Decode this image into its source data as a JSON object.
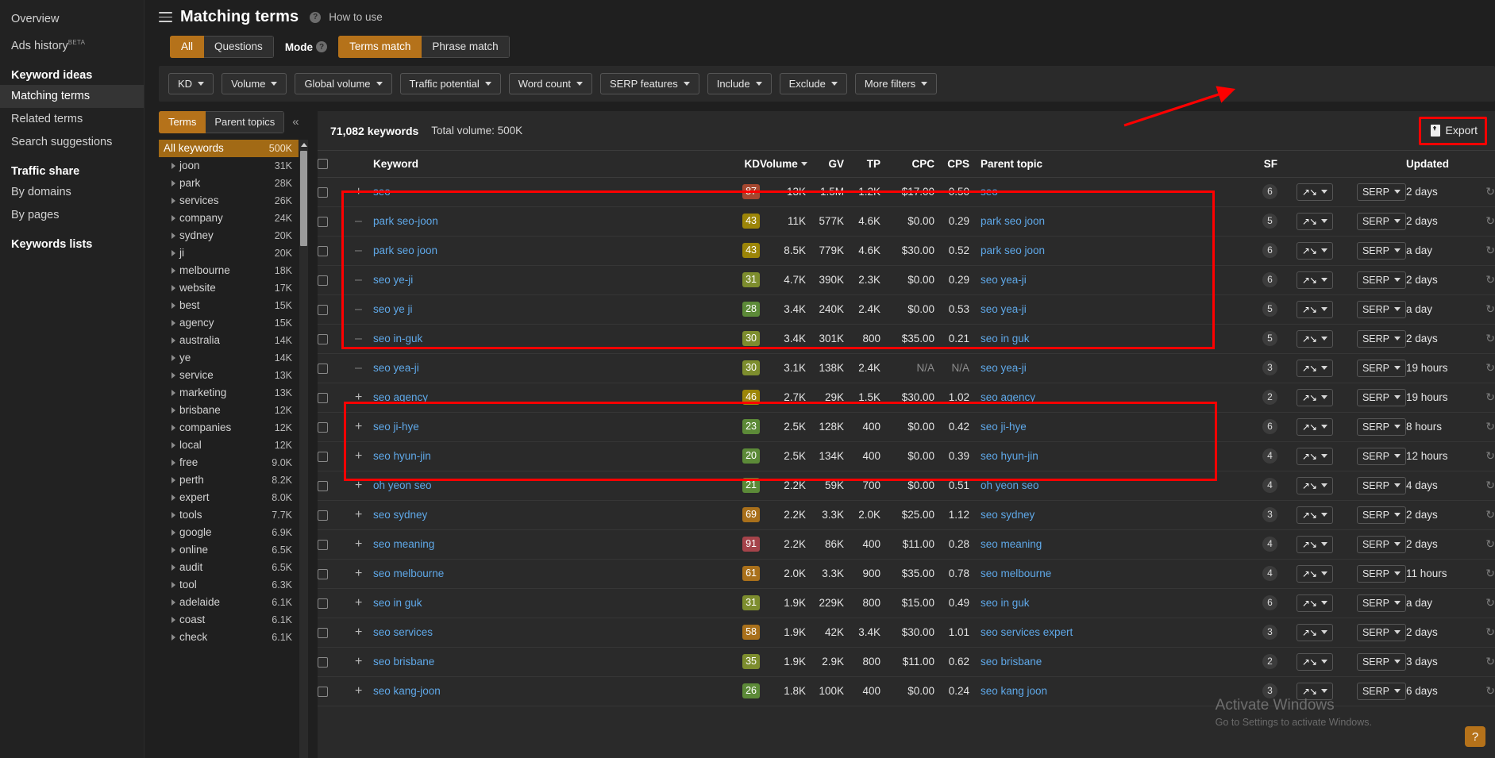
{
  "sidebar": {
    "top_items": [
      {
        "label": "Overview",
        "badge": ""
      },
      {
        "label": "Ads history",
        "badge": "BETA"
      }
    ],
    "sections": [
      {
        "title": "Keyword ideas",
        "items": [
          {
            "label": "Matching terms",
            "active": true
          },
          {
            "label": "Related terms",
            "active": false
          },
          {
            "label": "Search suggestions",
            "active": false
          }
        ]
      },
      {
        "title": "Traffic share",
        "items": [
          {
            "label": "By domains",
            "active": false
          },
          {
            "label": "By pages",
            "active": false
          }
        ]
      }
    ],
    "keywords_lists": "Keywords lists"
  },
  "header": {
    "title": "Matching terms",
    "how_to_use": "How to use",
    "help_icon": "question-mark-icon",
    "menu_icon": "hamburger-menu-icon"
  },
  "segments": {
    "scope": {
      "options": [
        "All",
        "Questions"
      ],
      "selected": "All"
    },
    "mode_label": "Mode",
    "mode": {
      "options": [
        "Terms match",
        "Phrase match"
      ],
      "selected": "Terms match"
    }
  },
  "filters": [
    {
      "label": "KD"
    },
    {
      "label": "Volume"
    },
    {
      "label": "Global volume"
    },
    {
      "label": "Traffic potential"
    },
    {
      "label": "Word count"
    },
    {
      "label": "SERP features"
    },
    {
      "label": "Include"
    },
    {
      "label": "Exclude"
    },
    {
      "label": "More filters"
    }
  ],
  "terms_panel": {
    "tabs": {
      "options": [
        "Terms",
        "Parent topics"
      ],
      "selected": "Terms"
    },
    "collapse_icon": "chevron-double-left-icon",
    "rows": [
      {
        "label": "All keywords",
        "count": "500K",
        "selected": true
      },
      {
        "label": "joon",
        "count": "31K",
        "selected": false
      },
      {
        "label": "park",
        "count": "28K",
        "selected": false
      },
      {
        "label": "services",
        "count": "26K",
        "selected": false
      },
      {
        "label": "company",
        "count": "24K",
        "selected": false
      },
      {
        "label": "sydney",
        "count": "20K",
        "selected": false
      },
      {
        "label": "ji",
        "count": "20K",
        "selected": false
      },
      {
        "label": "melbourne",
        "count": "18K",
        "selected": false
      },
      {
        "label": "website",
        "count": "17K",
        "selected": false
      },
      {
        "label": "best",
        "count": "15K",
        "selected": false
      },
      {
        "label": "agency",
        "count": "15K",
        "selected": false
      },
      {
        "label": "australia",
        "count": "14K",
        "selected": false
      },
      {
        "label": "ye",
        "count": "14K",
        "selected": false
      },
      {
        "label": "service",
        "count": "13K",
        "selected": false
      },
      {
        "label": "marketing",
        "count": "13K",
        "selected": false
      },
      {
        "label": "brisbane",
        "count": "12K",
        "selected": false
      },
      {
        "label": "companies",
        "count": "12K",
        "selected": false
      },
      {
        "label": "local",
        "count": "12K",
        "selected": false
      },
      {
        "label": "free",
        "count": "9.0K",
        "selected": false
      },
      {
        "label": "perth",
        "count": "8.2K",
        "selected": false
      },
      {
        "label": "expert",
        "count": "8.0K",
        "selected": false
      },
      {
        "label": "tools",
        "count": "7.7K",
        "selected": false
      },
      {
        "label": "google",
        "count": "6.9K",
        "selected": false
      },
      {
        "label": "online",
        "count": "6.5K",
        "selected": false
      },
      {
        "label": "audit",
        "count": "6.5K",
        "selected": false
      },
      {
        "label": "tool",
        "count": "6.3K",
        "selected": false
      },
      {
        "label": "adelaide",
        "count": "6.1K",
        "selected": false
      },
      {
        "label": "coast",
        "count": "6.1K",
        "selected": false
      },
      {
        "label": "check",
        "count": "6.1K",
        "selected": false
      }
    ]
  },
  "table": {
    "keyword_count": "71,082 keywords",
    "total_volume": "Total volume: 500K",
    "export_label": "Export",
    "export_icon": "download-document-icon",
    "columns": [
      "Keyword",
      "KD",
      "Volume",
      "GV",
      "TP",
      "CPC",
      "CPS",
      "Parent topic",
      "SF",
      "Updated"
    ],
    "sorted_column": "Volume",
    "serp_label": "SERP",
    "sparkline_icon": "sparkline-icon",
    "refresh_icon": "refresh-icon",
    "rows": [
      {
        "keyword": "seo",
        "kd": "87",
        "kd_color": "#a5472f",
        "volume": "13K",
        "gv": "1.5M",
        "tp": "1.2K",
        "cpc": "$17.00",
        "cps": "0.50",
        "parent": "seo",
        "sf": "6",
        "updated": "2 days",
        "expand": "plus"
      },
      {
        "keyword": "park seo-joon",
        "kd": "43",
        "kd_color": "#9c8508",
        "volume": "11K",
        "gv": "577K",
        "tp": "4.6K",
        "cpc": "$0.00",
        "cps": "0.29",
        "parent": "park seo joon",
        "sf": "5",
        "updated": "2 days",
        "expand": "minus"
      },
      {
        "keyword": "park seo joon",
        "kd": "43",
        "kd_color": "#9c8508",
        "volume": "8.5K",
        "gv": "779K",
        "tp": "4.6K",
        "cpc": "$30.00",
        "cps": "0.52",
        "parent": "park seo joon",
        "sf": "6",
        "updated": "a day",
        "expand": "minus"
      },
      {
        "keyword": "seo ye-ji",
        "kd": "31",
        "kd_color": "#7d8d2e",
        "volume": "4.7K",
        "gv": "390K",
        "tp": "2.3K",
        "cpc": "$0.00",
        "cps": "0.29",
        "parent": "seo yea-ji",
        "sf": "6",
        "updated": "2 days",
        "expand": "minus"
      },
      {
        "keyword": "seo ye ji",
        "kd": "28",
        "kd_color": "#5c8a38",
        "volume": "3.4K",
        "gv": "240K",
        "tp": "2.4K",
        "cpc": "$0.00",
        "cps": "0.53",
        "parent": "seo yea-ji",
        "sf": "5",
        "updated": "a day",
        "expand": "minus"
      },
      {
        "keyword": "seo in-guk",
        "kd": "30",
        "kd_color": "#7d8d2e",
        "volume": "3.4K",
        "gv": "301K",
        "tp": "800",
        "cpc": "$35.00",
        "cps": "0.21",
        "parent": "seo in guk",
        "sf": "5",
        "updated": "2 days",
        "expand": "minus"
      },
      {
        "keyword": "seo yea-ji",
        "kd": "30",
        "kd_color": "#7d8d2e",
        "volume": "3.1K",
        "gv": "138K",
        "tp": "2.4K",
        "cpc": "N/A",
        "cps": "N/A",
        "parent": "seo yea-ji",
        "sf": "3",
        "updated": "19 hours",
        "expand": "minus"
      },
      {
        "keyword": "seo agency",
        "kd": "46",
        "kd_color": "#9c8508",
        "volume": "2.7K",
        "gv": "29K",
        "tp": "1.5K",
        "cpc": "$30.00",
        "cps": "1.02",
        "parent": "seo agency",
        "sf": "2",
        "updated": "19 hours",
        "expand": "plus"
      },
      {
        "keyword": "seo ji-hye",
        "kd": "23",
        "kd_color": "#5c8a38",
        "volume": "2.5K",
        "gv": "128K",
        "tp": "400",
        "cpc": "$0.00",
        "cps": "0.42",
        "parent": "seo ji-hye",
        "sf": "6",
        "updated": "8 hours",
        "expand": "plus"
      },
      {
        "keyword": "seo hyun-jin",
        "kd": "20",
        "kd_color": "#5c8a38",
        "volume": "2.5K",
        "gv": "134K",
        "tp": "400",
        "cpc": "$0.00",
        "cps": "0.39",
        "parent": "seo hyun-jin",
        "sf": "4",
        "updated": "12 hours",
        "expand": "plus"
      },
      {
        "keyword": "oh yeon seo",
        "kd": "21",
        "kd_color": "#5c8a38",
        "volume": "2.2K",
        "gv": "59K",
        "tp": "700",
        "cpc": "$0.00",
        "cps": "0.51",
        "parent": "oh yeon seo",
        "sf": "4",
        "updated": "4 days",
        "expand": "plus"
      },
      {
        "keyword": "seo sydney",
        "kd": "69",
        "kd_color": "#a9701b",
        "volume": "2.2K",
        "gv": "3.3K",
        "tp": "2.0K",
        "cpc": "$25.00",
        "cps": "1.12",
        "parent": "seo sydney",
        "sf": "3",
        "updated": "2 days",
        "expand": "plus"
      },
      {
        "keyword": "seo meaning",
        "kd": "91",
        "kd_color": "#a5434a",
        "volume": "2.2K",
        "gv": "86K",
        "tp": "400",
        "cpc": "$11.00",
        "cps": "0.28",
        "parent": "seo meaning",
        "sf": "4",
        "updated": "2 days",
        "expand": "plus"
      },
      {
        "keyword": "seo melbourne",
        "kd": "61",
        "kd_color": "#a9701b",
        "volume": "2.0K",
        "gv": "3.3K",
        "tp": "900",
        "cpc": "$35.00",
        "cps": "0.78",
        "parent": "seo melbourne",
        "sf": "4",
        "updated": "11 hours",
        "expand": "plus"
      },
      {
        "keyword": "seo in guk",
        "kd": "31",
        "kd_color": "#7d8d2e",
        "volume": "1.9K",
        "gv": "229K",
        "tp": "800",
        "cpc": "$15.00",
        "cps": "0.49",
        "parent": "seo in guk",
        "sf": "6",
        "updated": "a day",
        "expand": "plus"
      },
      {
        "keyword": "seo services",
        "kd": "58",
        "kd_color": "#a9701b",
        "volume": "1.9K",
        "gv": "42K",
        "tp": "3.4K",
        "cpc": "$30.00",
        "cps": "1.01",
        "parent": "seo services expert",
        "sf": "3",
        "updated": "2 days",
        "expand": "plus"
      },
      {
        "keyword": "seo brisbane",
        "kd": "35",
        "kd_color": "#7d8d2e",
        "volume": "1.9K",
        "gv": "2.9K",
        "tp": "800",
        "cpc": "$11.00",
        "cps": "0.62",
        "parent": "seo brisbane",
        "sf": "2",
        "updated": "3 days",
        "expand": "plus"
      },
      {
        "keyword": "seo kang-joon",
        "kd": "26",
        "kd_color": "#5c8a38",
        "volume": "1.8K",
        "gv": "100K",
        "tp": "400",
        "cpc": "$0.00",
        "cps": "0.24",
        "parent": "seo kang joon",
        "sf": "3",
        "updated": "6 days",
        "expand": "plus"
      }
    ]
  },
  "watermark": {
    "line1": "Activate Windows",
    "line2": "Go to Settings to activate Windows."
  },
  "help_fab": "?",
  "colors": {
    "accent": "#b5721a",
    "link": "#5fa8e8",
    "annotation": "#ff0000"
  }
}
